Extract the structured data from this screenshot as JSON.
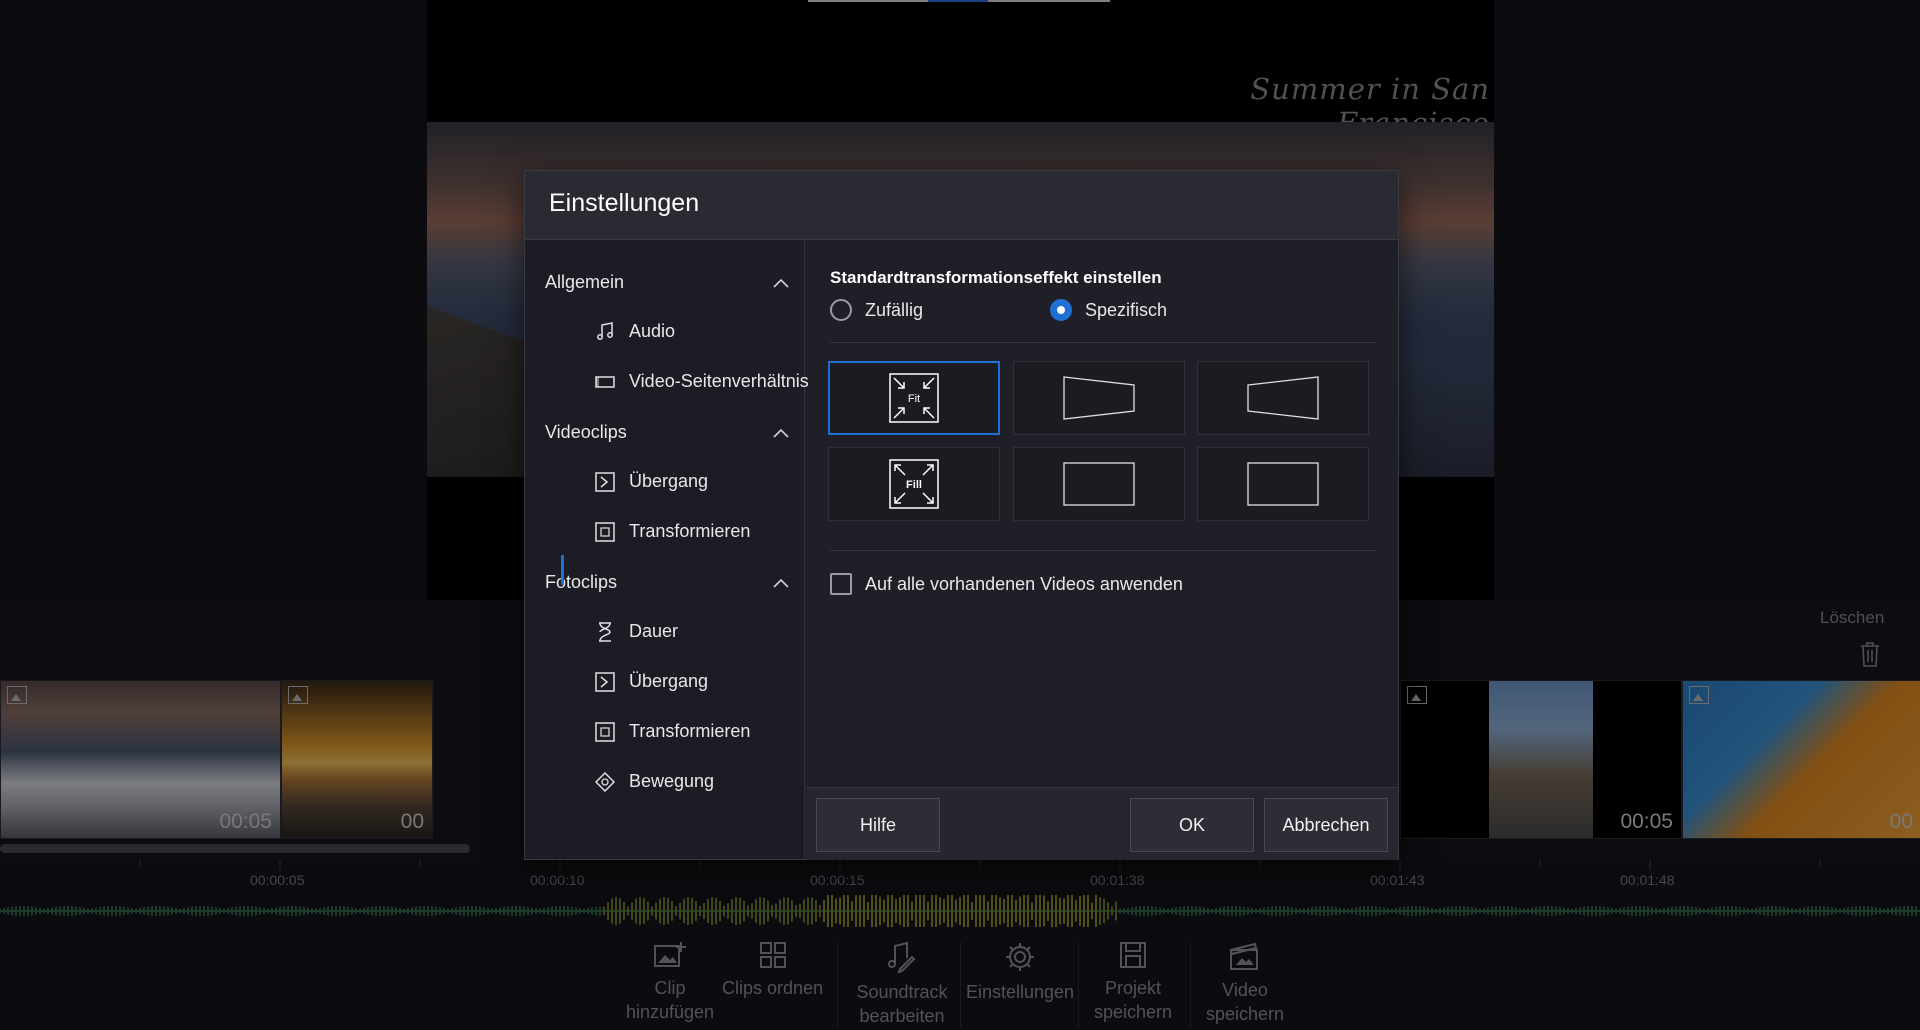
{
  "preview": {
    "title_overlay": "Summer in San Francisco"
  },
  "timeline": {
    "clips": [
      {
        "duration": "00:05"
      },
      {
        "duration": "00"
      },
      {
        "duration": "00:05"
      },
      {
        "duration": "00"
      }
    ],
    "delete_label": "Löschen",
    "ruler_ticks": [
      "00:00:05",
      "00:00:10",
      "00:00:15",
      "00:01:38",
      "00:01:43",
      "00:01:48"
    ]
  },
  "toolbar": {
    "add_clip": "Clip hinzufügen",
    "arrange_clips": "Clips ordnen",
    "edit_soundtrack": "Soundtrack bearbeiten",
    "settings": "Einstellungen",
    "save_project": "Projekt speichern",
    "save_video": "Video speichern"
  },
  "dialog": {
    "title": "Einstellungen",
    "nav": {
      "general": "Allgemein",
      "audio": "Audio",
      "aspect_ratio": "Video-Seitenverhältnis",
      "videoclips": "Videoclips",
      "video_transition": "Übergang",
      "video_transform": "Transformieren",
      "photoclips": "Fotoclips",
      "duration": "Dauer",
      "photo_transition": "Übergang",
      "photo_transform": "Transformieren",
      "motion": "Bewegung"
    },
    "content": {
      "section_title": "Standardtransformationseffekt einstellen",
      "radio_random": "Zufällig",
      "radio_specific": "Spezifisch",
      "selected_radio": "Spezifisch",
      "tile_fit": "Fit",
      "tile_fill": "Fill",
      "apply_all": "Auf alle vorhandenen Videos anwenden",
      "apply_all_checked": false
    },
    "buttons": {
      "help": "Hilfe",
      "ok": "OK",
      "cancel": "Abbrechen"
    }
  },
  "colors": {
    "accent": "#1e6fd6",
    "dialog_bg": "#1f1f27",
    "header_bg": "#2a2a33"
  }
}
